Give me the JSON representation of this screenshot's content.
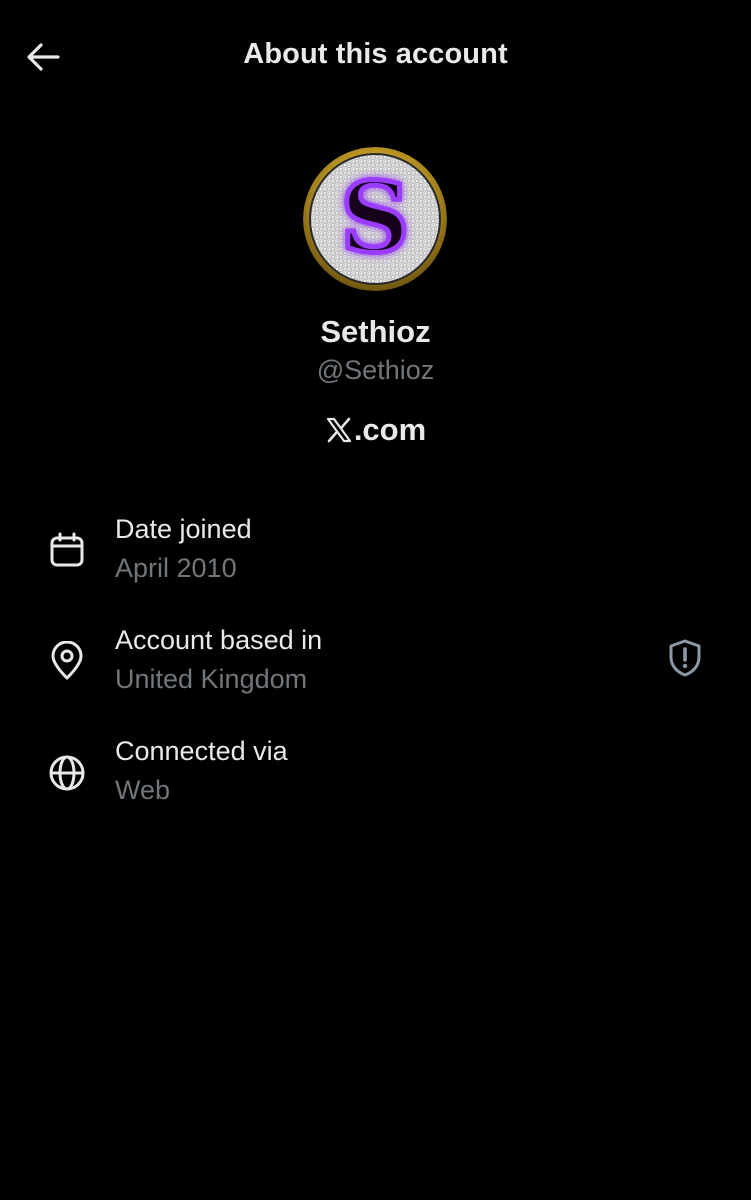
{
  "header": {
    "title": "About this account",
    "back_icon": "arrow-left-icon"
  },
  "profile": {
    "display_name": "Sethioz",
    "handle": "@Sethioz",
    "avatar_letter": "S",
    "platform_text": ".com",
    "platform_logo": "x-logo-icon"
  },
  "details": [
    {
      "icon": "calendar-icon",
      "label": "Date joined",
      "value": "April 2010"
    },
    {
      "icon": "location-pin-icon",
      "label": "Account based in",
      "value": "United Kingdom",
      "trailing_icon": "shield-alert-icon"
    },
    {
      "icon": "globe-icon",
      "label": "Connected via",
      "value": "Web"
    }
  ],
  "colors": {
    "background": "#000000",
    "primary_text": "#e7e9ea",
    "secondary_text": "#71767b",
    "avatar_ring": "#c9a227",
    "avatar_letter": "#9b3cff"
  }
}
